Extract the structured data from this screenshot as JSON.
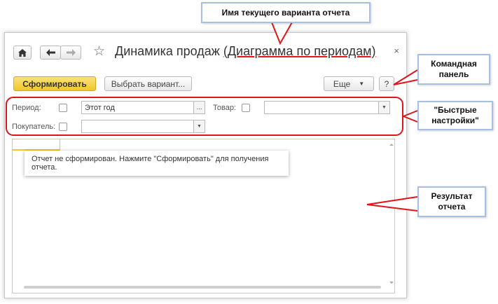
{
  "window": {
    "title": "Динамика продаж (Диаграмма по периодам)",
    "close_symbol": "×",
    "nav": {
      "home_icon": "home-icon",
      "back_icon": "arrow-left-icon",
      "forward_icon": "arrow-right-icon",
      "favorite_icon": "star-icon"
    }
  },
  "toolbar": {
    "generate_label": "Сформировать",
    "select_variant_label": "Выбрать вариант...",
    "more_label": "Еще",
    "help_label": "?",
    "accent_color": "#f5d23c"
  },
  "quick_settings": {
    "period_label": "Период:",
    "period_value": "Этот год",
    "period_button": "...",
    "product_label": "Товар:",
    "product_value": "",
    "buyer_label": "Покупатель:",
    "buyer_value": ""
  },
  "result": {
    "message": "Отчет не сформирован. Нажмите \"Сформировать\" для получения отчета."
  },
  "callouts": {
    "variant_name": "Имя текущего варианта отчета",
    "command_panel": "Командная панель",
    "quick_settings": "\"Быстрые настройки\"",
    "report_result": "Результат отчета"
  },
  "colors": {
    "annotation_red": "#e0151b",
    "callout_border": "#a7bfe0"
  }
}
